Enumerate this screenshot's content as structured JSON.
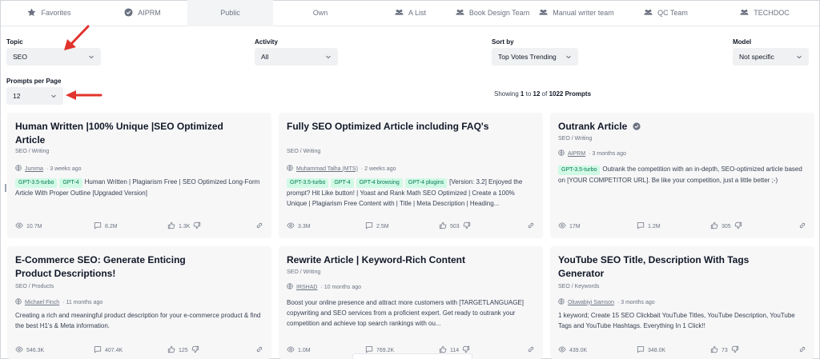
{
  "tabs": [
    {
      "label": "Favorites",
      "icon": "star-icon",
      "active": false
    },
    {
      "label": "AIPRM",
      "icon": "verified-icon",
      "active": false
    },
    {
      "label": "Public",
      "icon": "",
      "active": true
    },
    {
      "label": "Own",
      "icon": "",
      "active": false
    },
    {
      "label": "A List",
      "icon": "team-icon",
      "active": false
    },
    {
      "label": "Book Design Team",
      "icon": "team-icon",
      "active": false
    },
    {
      "label": "Manual writer team",
      "icon": "team-icon",
      "active": false
    },
    {
      "label": "QC Team",
      "icon": "team-icon",
      "active": false
    },
    {
      "label": "TECHDOC",
      "icon": "team-icon",
      "active": false
    }
  ],
  "filters": {
    "topic": {
      "label": "Topic",
      "value": "SEO"
    },
    "activity": {
      "label": "Activity",
      "value": "All"
    },
    "sort": {
      "label": "Sort by",
      "value": "Top Votes Trending"
    },
    "model": {
      "label": "Model",
      "value": "Not specific"
    },
    "per_page": {
      "label": "Prompts per Page",
      "value": "12"
    }
  },
  "showing": {
    "prefix": "Showing",
    "from": "1",
    "to_word": "to",
    "to": "12",
    "of_word": "of",
    "total": "1022 Prompts"
  },
  "colors": {
    "arrow": "#e0342c",
    "badge_bg": "#d1fae5",
    "badge_text": "#047857",
    "card_bg": "#f7f7f8"
  },
  "cards": [
    {
      "title": "Human Written |100% Unique |SEO Optimized Article",
      "category": "SEO / Writing",
      "author": "Jumma",
      "time": "· 3 weeks ago",
      "verified": false,
      "badges": [
        "GPT-3.5-turbo",
        "GPT-4"
      ],
      "desc": "Human Written | Plagiarism Free | SEO Optimized Long-Form Article With Proper Outline [Upgraded Version]",
      "views": "10.7M",
      "comments": "8.2M",
      "likes": "1.3K"
    },
    {
      "title": "Fully SEO Optimized Article including FAQ's",
      "category": "SEO / Writing",
      "author": "Muhammad Talha (MTS)",
      "time": "· 2 weeks ago",
      "verified": false,
      "badges": [
        "GPT-3.5-turbo",
        "GPT-4",
        "GPT-4 browsing",
        "GPT-4 plugins"
      ],
      "desc": "[Version: 3.2] Enjoyed the prompt? Hit Like button! | Yoast and Rank Math SEO Optimized | Create a 100% Unique | Plagiarism Free Content with | Title | Meta Description | Heading...",
      "views": "3.3M",
      "comments": "2.5M",
      "likes": "503"
    },
    {
      "title": "Outrank Article",
      "category": "SEO / Writing",
      "author": "AIPRM",
      "time": "· 3 months ago",
      "verified": true,
      "badges": [
        "GPT-3.5-turbo"
      ],
      "desc": "Outrank the competition with an in-depth, SEO-optimized article based on [YOUR COMPETITOR URL]. Be like your competition, just a little better ;-)",
      "views": "17M",
      "comments": "1.2M",
      "likes": "305"
    },
    {
      "title": "E-Commerce SEO: Generate Enticing Product Descriptions!",
      "category": "SEO / Products",
      "author": "Michael Finch",
      "time": "· 11 months ago",
      "verified": false,
      "badges": [],
      "desc": "Creating a rich and meaningful product description for your e-commerce product & find the best H1's & Meta information.",
      "views": "546.3K",
      "comments": "407.4K",
      "likes": "125"
    },
    {
      "title": "Rewrite Article | Keyword-Rich Content",
      "category": "SEO / Writing",
      "author": "IRSHAD",
      "time": "· 10 months ago",
      "verified": false,
      "badges": [],
      "desc": "Boost your online presence and attract more customers with [TARGETLANGUAGE] copywriting and SEO services from a proficient expert. Get ready to outrank your competition and achieve top search rankings with ou...",
      "views": "1.0M",
      "comments": "769.2K",
      "likes": "114"
    },
    {
      "title": "YouTube SEO Title, Description With Tags Generator",
      "category": "SEO / Keywords",
      "author": "Oluwabiyi Samson",
      "time": "· 3 months ago",
      "verified": false,
      "badges": [],
      "desc": "1 keyword; Create 15 SEO Clickbait YouTube Titles, YouTube Description, YouTube Tags and YouTube Hashtags. Everything In 1 Click!!",
      "views": "439.0K",
      "comments": "348.0K",
      "likes": "73"
    }
  ]
}
